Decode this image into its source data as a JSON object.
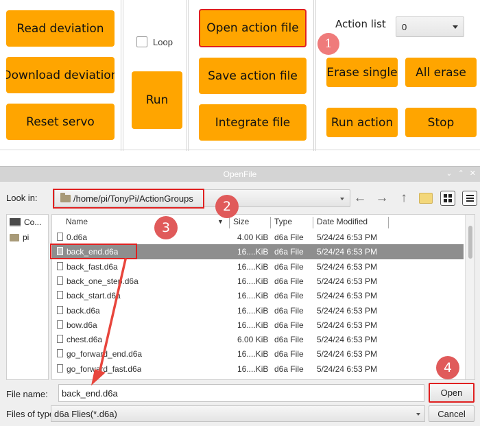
{
  "panel": {
    "read_deviation": "Read deviation",
    "download_deviation": "Download deviation",
    "reset_servo": "Reset servo",
    "loop_label": "Loop",
    "run": "Run",
    "open_action_file": "Open action file",
    "save_action_file": "Save action file",
    "integrate_file": "Integrate file",
    "action_list_label": "Action list",
    "action_list_value": "0",
    "erase_single": "Erase single",
    "all_erase": "All erase",
    "run_action": "Run action",
    "stop": "Stop",
    "accent_color": "#ffa500"
  },
  "badges": {
    "b1": "1",
    "b2": "2",
    "b3": "3",
    "b4": "4"
  },
  "dialog": {
    "title": "OpenFile",
    "look_in_label": "Look in:",
    "look_in_path": "/home/pi/TonyPi/ActionGroups",
    "sidebar": [
      {
        "label": "Co...",
        "icon": "computer-icon"
      },
      {
        "label": "pi",
        "icon": "folder-icon"
      }
    ],
    "columns": {
      "name": "Name",
      "size": "Size",
      "type": "Type",
      "date": "Date Modified"
    },
    "files": [
      {
        "name": "0.d6a",
        "size": "4.00 KiB",
        "type": "d6a File",
        "date": "5/24/24 6:53 PM"
      },
      {
        "name": "back_end.d6a",
        "size": "16....KiB",
        "type": "d6a File",
        "date": "5/24/24 6:53 PM",
        "selected": true
      },
      {
        "name": "back_fast.d6a",
        "size": "16....KiB",
        "type": "d6a File",
        "date": "5/24/24 6:53 PM"
      },
      {
        "name": "back_one_step.d6a",
        "size": "16....KiB",
        "type": "d6a File",
        "date": "5/24/24 6:53 PM"
      },
      {
        "name": "back_start.d6a",
        "size": "16....KiB",
        "type": "d6a File",
        "date": "5/24/24 6:53 PM"
      },
      {
        "name": "back.d6a",
        "size": "16....KiB",
        "type": "d6a File",
        "date": "5/24/24 6:53 PM"
      },
      {
        "name": "bow.d6a",
        "size": "16....KiB",
        "type": "d6a File",
        "date": "5/24/24 6:53 PM"
      },
      {
        "name": "chest.d6a",
        "size": "6.00 KiB",
        "type": "d6a File",
        "date": "5/24/24 6:53 PM"
      },
      {
        "name": "go_forward_end.d6a",
        "size": "16....KiB",
        "type": "d6a File",
        "date": "5/24/24 6:53 PM"
      },
      {
        "name": "go_forward_fast.d6a",
        "size": "16....KiB",
        "type": "d6a File",
        "date": "5/24/24 6:53 PM"
      }
    ],
    "file_name_label": "File name:",
    "file_name_value": "back_end.d6a",
    "files_of_type_label": "Files of type:",
    "files_of_type_value": "d6a Flies(*.d6a)",
    "open_button": "Open",
    "cancel_button": "Cancel"
  }
}
